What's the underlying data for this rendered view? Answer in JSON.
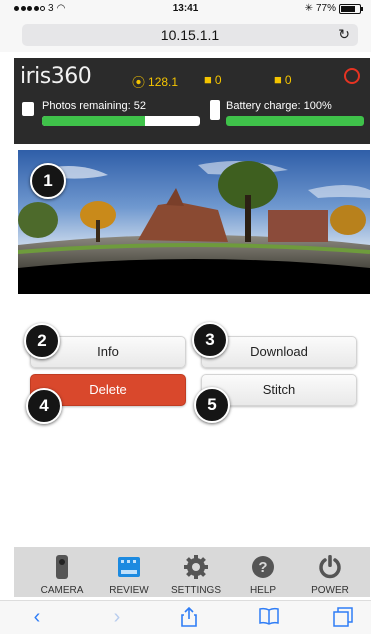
{
  "statusbar": {
    "carrier": "3",
    "time": "13:41",
    "battery": "77%"
  },
  "browser": {
    "url": "10.15.1.1"
  },
  "app": {
    "logo": "iris360",
    "stats": [
      {
        "icon": "compass-icon",
        "value": "128.1"
      },
      {
        "icon": "camera-slot-icon",
        "value": "0"
      },
      {
        "icon": "card-icon",
        "value": "0"
      }
    ],
    "photos_label": "Photos remaining: 52",
    "photos_fill": 0.65,
    "battery_label": "Battery charge: 100%",
    "battery_fill": 1.0,
    "colors": {
      "accent_green": "#3fc24a",
      "stat_yellow": "#f4c400",
      "alert_red": "#e53322",
      "delete_red": "#d9482c"
    }
  },
  "badges": [
    "1",
    "2",
    "3",
    "4",
    "5"
  ],
  "buttons": {
    "info": "Info",
    "download": "Download",
    "delete": "Delete",
    "stitch": "Stitch"
  },
  "tabs": [
    {
      "label": "CAMERA",
      "icon": "camera-icon",
      "active": false
    },
    {
      "label": "REVIEW",
      "icon": "film-icon",
      "active": true
    },
    {
      "label": "SETTINGS",
      "icon": "gear-icon",
      "active": false
    },
    {
      "label": "HELP",
      "icon": "help-icon",
      "active": false
    },
    {
      "label": "POWER",
      "icon": "power-icon",
      "active": false
    }
  ]
}
